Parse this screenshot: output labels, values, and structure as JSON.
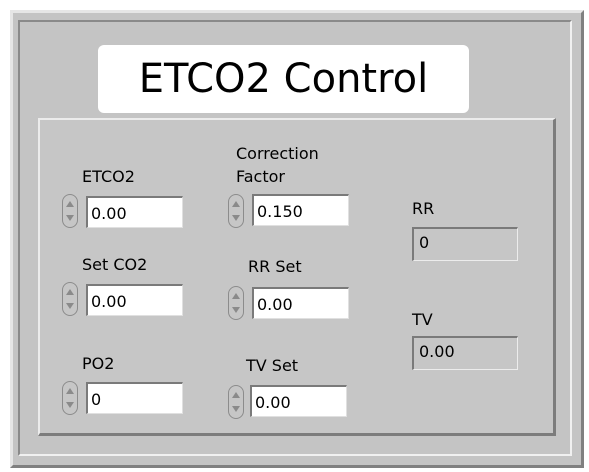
{
  "window": {
    "title": "ETCO2 Control"
  },
  "controls": {
    "etco2": {
      "label": "ETCO2",
      "value": "0.00"
    },
    "set_co2": {
      "label": "Set CO2",
      "value": "0.00"
    },
    "po2": {
      "label": "PO2",
      "value": "0"
    },
    "correction_factor": {
      "label_line1": "Correction",
      "label_line2": "Factor",
      "value": "0.150"
    },
    "rr_set": {
      "label": "RR Set",
      "value": "0.00"
    },
    "tv_set": {
      "label": "TV Set",
      "value": "0.00"
    }
  },
  "indicators": {
    "rr": {
      "label": "RR",
      "value": "0"
    },
    "tv": {
      "label": "TV",
      "value": "0.00"
    }
  },
  "colors": {
    "panel": "#c6c6c6",
    "field": "#ffffff",
    "indicator": "#c6c6c6"
  }
}
